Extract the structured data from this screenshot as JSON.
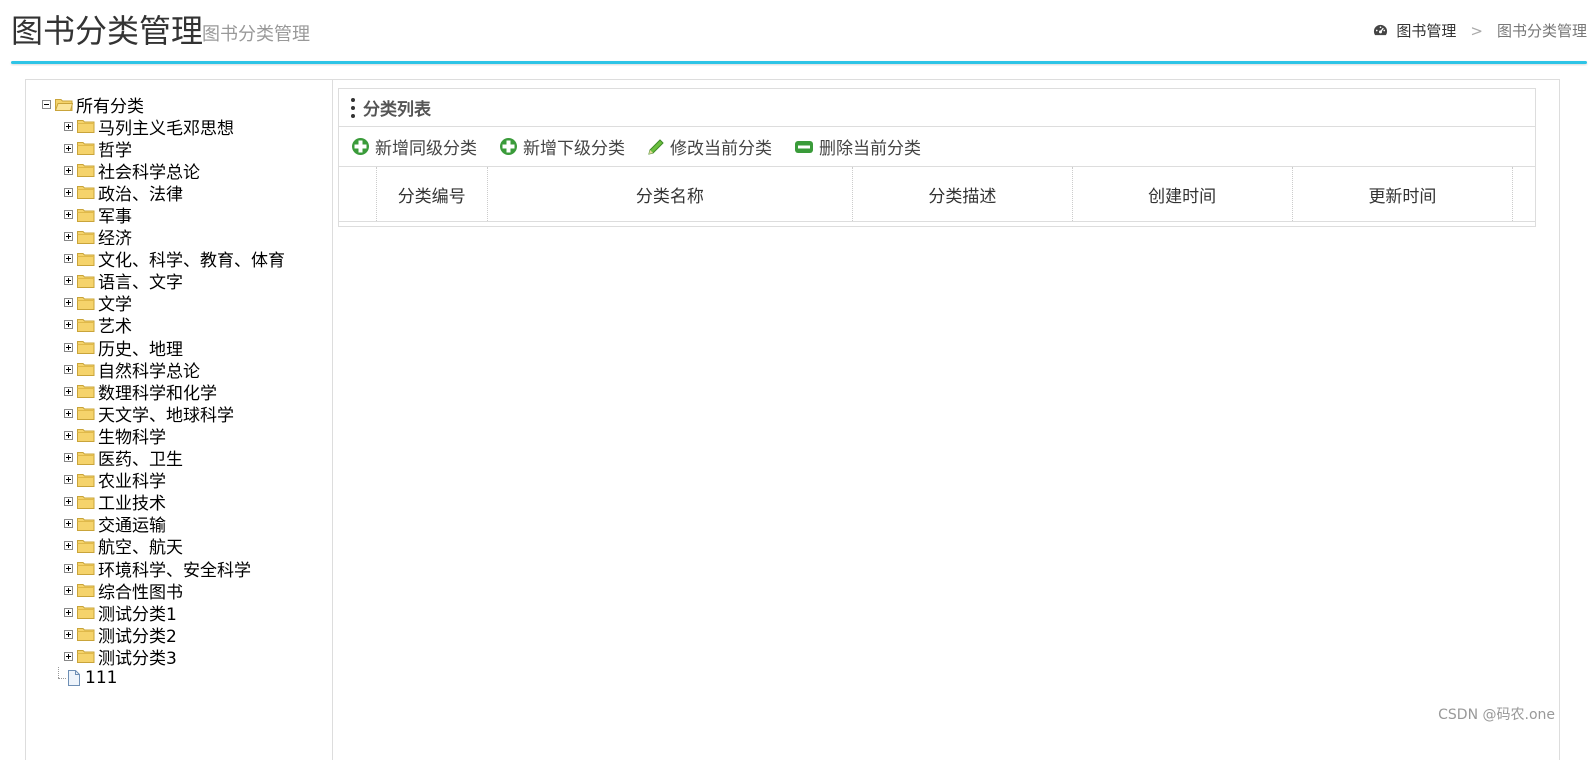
{
  "header": {
    "title": "图书分类管理",
    "subtitle": "图书分类管理",
    "breadcrumb": {
      "root_icon": "dashboard-icon",
      "root_label": "图书管理",
      "separator": ">",
      "current": "图书分类管理"
    }
  },
  "tree": {
    "root_label": "所有分类",
    "items": [
      "马列主义毛邓思想",
      "哲学",
      "社会科学总论",
      "政治、法律",
      "军事",
      "经济",
      "文化、科学、教育、体育",
      "语言、文字",
      "文学",
      "艺术",
      "历史、地理",
      "自然科学总论",
      "数理科学和化学",
      "天文学、地球科学",
      "生物科学",
      "医药、卫生",
      "农业科学",
      "工业技术",
      "交通运输",
      "航空、航天",
      "环境科学、安全科学",
      "综合性图书",
      "测试分类1",
      "测试分类2",
      "测试分类3"
    ],
    "leaf_label": "111"
  },
  "list": {
    "title": "分类列表",
    "toolbar": {
      "add_sibling": "新增同级分类",
      "add_child": "新增下级分类",
      "edit": "修改当前分类",
      "delete": "删除当前分类"
    },
    "columns": [
      "分类编号",
      "分类名称",
      "分类描述",
      "创建时间",
      "更新时间"
    ]
  },
  "watermark": "CSDN @码农.one",
  "colors": {
    "accent_line": "#2ec4e6",
    "add_icon": "#3a9b3a",
    "edit_icon": "#4caa3a",
    "folder": "#f5d36b"
  }
}
